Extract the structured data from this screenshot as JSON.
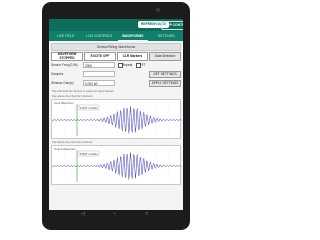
{
  "header": {
    "btn_primary": "REFRESH DATA",
    "btn_secondary": "APP CONTROL"
  },
  "tabs": [
    {
      "label": "LIVE FIELD"
    },
    {
      "label": "LOG CONTROLS"
    },
    {
      "label": "WAVEFORMS"
    },
    {
      "label": "SETTINGS"
    }
  ],
  "section_title": "Sensor/String Waveforms",
  "controls": {
    "waveform_button": "WAVEFORM STOPPED",
    "exciter_button": "EXCITE OFF",
    "markers_button": "CLR Markers",
    "data_selection_button": "Data Selection",
    "sensor_freq_label": "Sensor Freq (0-9k)",
    "sensor_freq_value": "2000",
    "repeat_label": "Repeat",
    "fft_label": "FFT",
    "samples_label": "Samples",
    "samples_value": "",
    "get_button": "GET SETTINGS",
    "window_label": "Window Gain(s)",
    "window_value": "0.000 kE",
    "set_button": "APPLY SETTINGS"
  },
  "hint_text": "Tap and hold the Sensor to select an Input Sensor",
  "charts": [
    {
      "hint": "Tap above the chart for functions",
      "label": "Input Waveform",
      "marker": "0.847 mV/div"
    },
    {
      "hint": "Tap above the chart for functions",
      "label": "Output Waveform",
      "marker": "0.847 mV/div"
    }
  ],
  "nav": {
    "back": "◁",
    "home": "○",
    "recents": "□"
  },
  "colors": {
    "accent": "#0e6d5a",
    "waveform": "#3d3fb5",
    "marker": "#2ea32e"
  }
}
